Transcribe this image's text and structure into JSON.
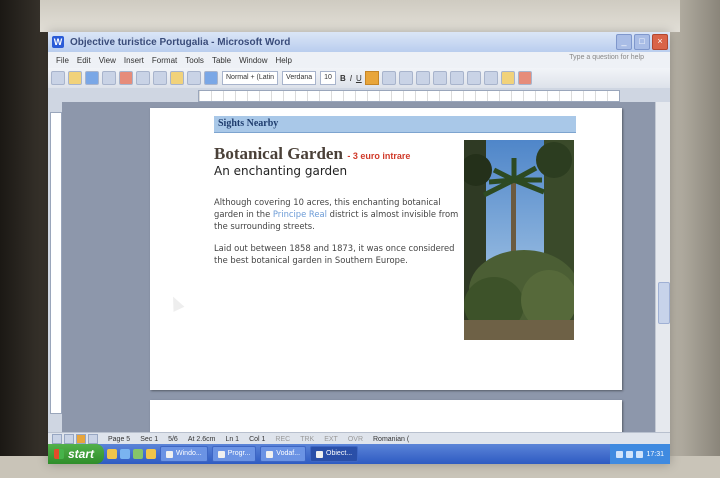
{
  "window": {
    "title": "Objective turistice Portugalia - Microsoft Word",
    "app_icon": "W"
  },
  "menu": {
    "items": [
      "File",
      "Edit",
      "View",
      "Insert",
      "Format",
      "Tools",
      "Table",
      "Window",
      "Help"
    ],
    "help_placeholder": "Type a question for help"
  },
  "toolbar": {
    "style": "Normal + (Latin",
    "font": "Verdana",
    "size": "10",
    "bold": "B",
    "italic": "I",
    "underline": "U"
  },
  "document": {
    "section_bar": "Sights Nearby",
    "heading": "Botanical Garden",
    "price": "- 3 euro intrare",
    "subheading": "An enchanting garden",
    "para1_before": "Although covering 10 acres, this enchanting botanical garden in the ",
    "para1_link": "Principe Real",
    "para1_after": " district is almost invisible from the surrounding streets.",
    "para2": "Laid out between 1858 and 1873, it was once considered the best botanical garden in Southern Europe."
  },
  "status": {
    "page": "Page 5",
    "sec": "Sec 1",
    "pages": "5/6",
    "at": "At 2.6cm",
    "ln": "Ln 1",
    "col": "Col 1",
    "rec": "REC",
    "trk": "TRK",
    "ext": "EXT",
    "ovr": "OVR",
    "lang": "Romanian ("
  },
  "taskbar": {
    "start": "start",
    "buttons": [
      "Windo...",
      "Progr...",
      "Vodaf...",
      "Obiect..."
    ],
    "time": "17:31"
  },
  "colors": {
    "section_bar": "#a9c8e8",
    "price_red": "#d03a2a",
    "link_blue": "#6c9bd6",
    "title_gradient": "#b9cdee"
  }
}
